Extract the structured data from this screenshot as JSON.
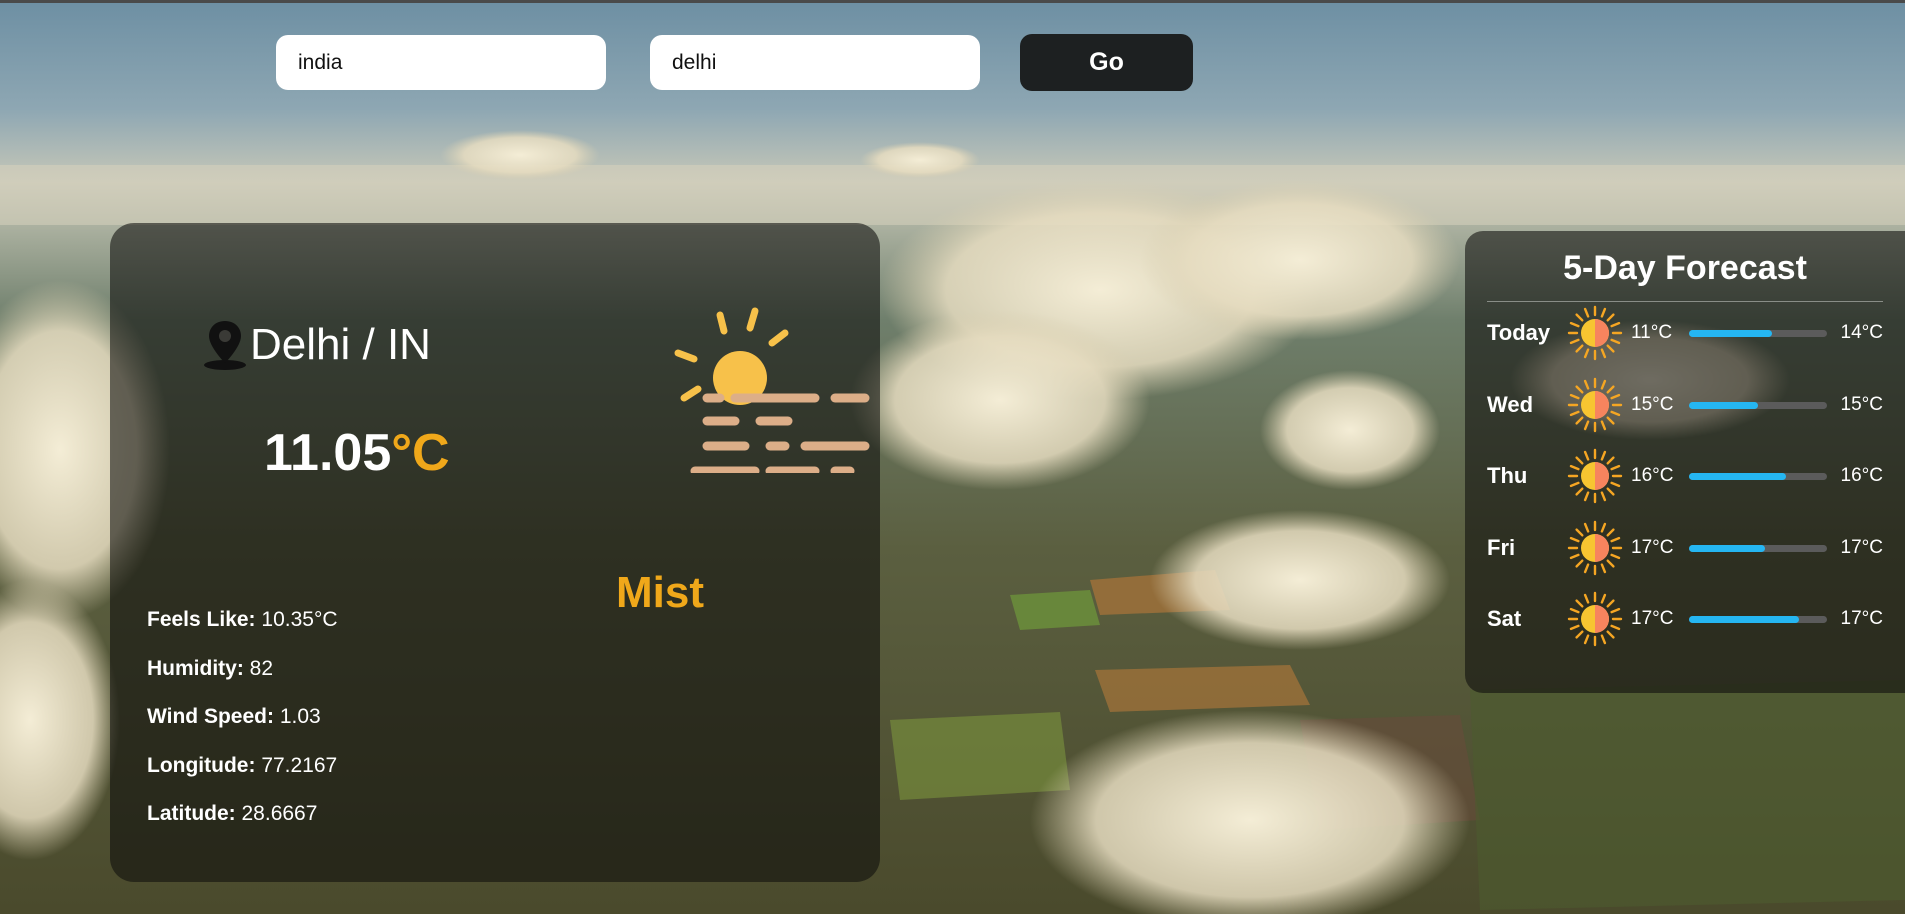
{
  "search": {
    "country_value": "india",
    "city_value": "delhi",
    "go_label": "Go"
  },
  "current": {
    "location": "Delhi / IN",
    "temperature": "11.05",
    "unit": "°C",
    "condition": "Mist",
    "details": [
      {
        "label": "Feels Like:",
        "value": "10.35°C"
      },
      {
        "label": "Humidity:",
        "value": "82"
      },
      {
        "label": "Wind Speed:",
        "value": "1.03"
      },
      {
        "label": "Longitude:",
        "value": "77.2167"
      },
      {
        "label": "Latitude:",
        "value": "28.6667"
      }
    ]
  },
  "forecast": {
    "title": "5-Day Forecast",
    "days": [
      {
        "day": "Today",
        "low": "11°C",
        "high": "14°C",
        "bar_fill": 0.6
      },
      {
        "day": "Wed",
        "low": "15°C",
        "high": "15°C",
        "bar_fill": 0.5
      },
      {
        "day": "Thu",
        "low": "16°C",
        "high": "16°C",
        "bar_fill": 0.7
      },
      {
        "day": "Fri",
        "low": "17°C",
        "high": "17°C",
        "bar_fill": 0.55
      },
      {
        "day": "Sat",
        "low": "17°C",
        "high": "17°C",
        "bar_fill": 0.8
      }
    ]
  },
  "colors": {
    "accent": "#f0a81a",
    "bar": "#25b6f2",
    "button": "#1d2021"
  },
  "icons": {
    "location": "location-pin-icon",
    "current_weather": "mist-sun-icon",
    "forecast": "sun-icon"
  }
}
